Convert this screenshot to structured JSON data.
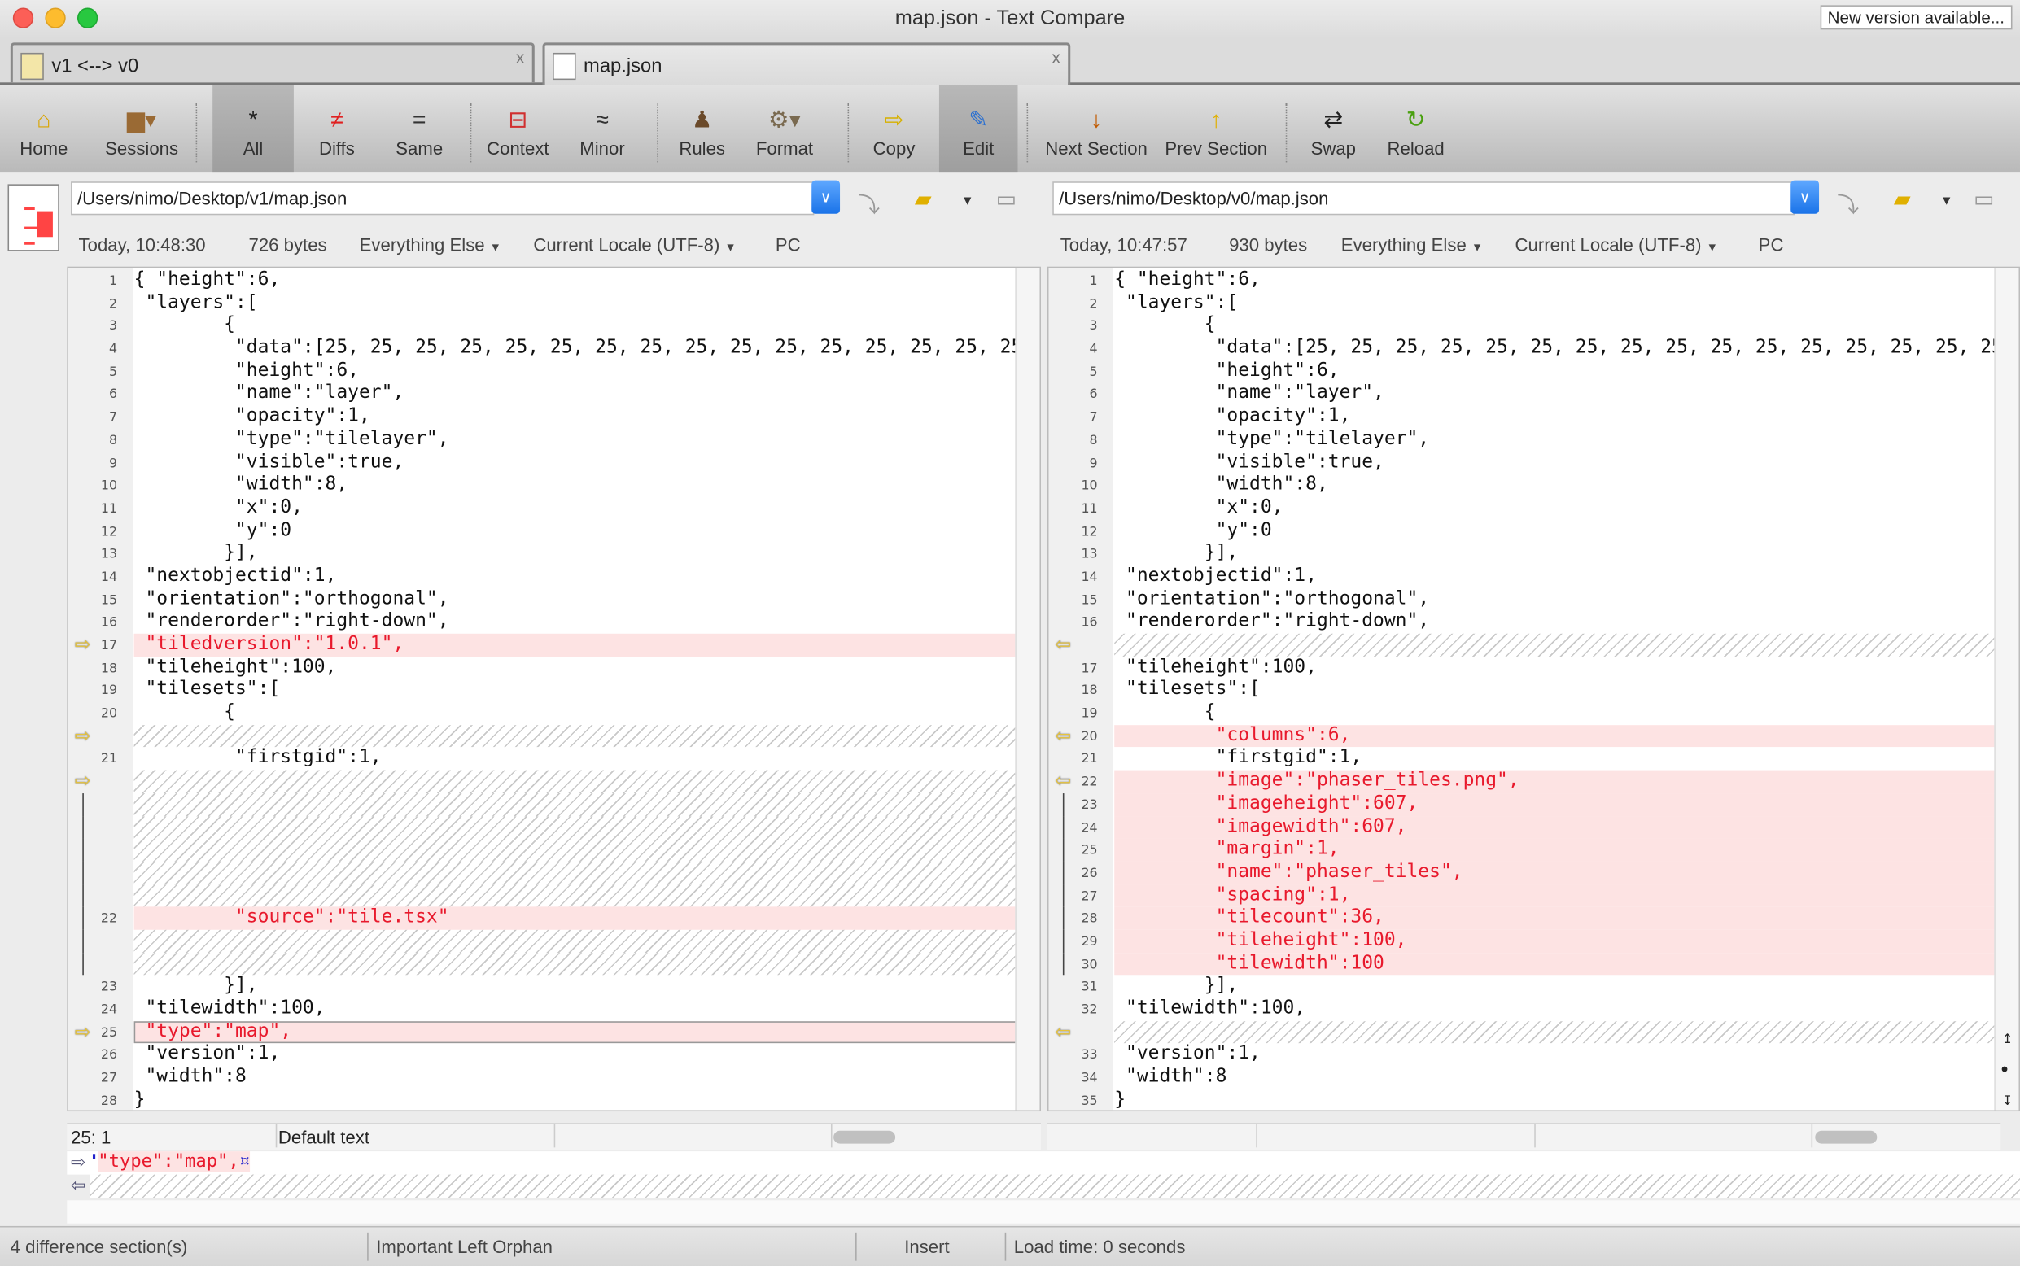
{
  "window": {
    "title": "map.json - Text Compare",
    "new_version": "New version available..."
  },
  "tabs": [
    {
      "label": "v1 <--> v0",
      "icon": "folder-compare-icon",
      "close": "x"
    },
    {
      "label": "map.json",
      "icon": "text-compare-icon",
      "close": "x"
    }
  ],
  "toolbar": [
    {
      "label": "Home",
      "icon": "home-icon",
      "glyph": "⌂",
      "color": "#d9a400"
    },
    {
      "label": "Sessions",
      "icon": "briefcase-icon",
      "glyph": "▆▾",
      "color": "#9a6a34"
    },
    {
      "label": "All",
      "icon": "asterisk-icon",
      "glyph": "*",
      "color": "#222",
      "pressed": true
    },
    {
      "label": "Diffs",
      "icon": "not-equal-icon",
      "glyph": "≠",
      "color": "#e02020"
    },
    {
      "label": "Same",
      "icon": "equal-icon",
      "glyph": "=",
      "color": "#333"
    },
    {
      "label": "Context",
      "icon": "context-icon",
      "glyph": "⊟",
      "color": "#d03030"
    },
    {
      "label": "Minor",
      "icon": "approx-icon",
      "glyph": "≈",
      "color": "#333"
    },
    {
      "label": "Rules",
      "icon": "referee-icon",
      "glyph": "♟",
      "color": "#6b4a2a"
    },
    {
      "label": "Format",
      "icon": "format-gear-icon",
      "glyph": "⚙▾",
      "color": "#7a6a50"
    },
    {
      "label": "Copy",
      "icon": "copy-arrow-icon",
      "glyph": "⇨",
      "color": "#d6b000"
    },
    {
      "label": "Edit",
      "icon": "edit-pencil-icon",
      "glyph": "✎",
      "color": "#2a6fd0",
      "pressed": true
    },
    {
      "label": "Next Section",
      "icon": "arrow-down-icon",
      "glyph": "↓",
      "color": "#c05a00"
    },
    {
      "label": "Prev Section",
      "icon": "arrow-up-icon",
      "glyph": "↑",
      "color": "#e0b000"
    },
    {
      "label": "Swap",
      "icon": "swap-icon",
      "glyph": "⇄",
      "color": "#222"
    },
    {
      "label": "Reload",
      "icon": "reload-icon",
      "glyph": "↻",
      "color": "#4aa010"
    }
  ],
  "left": {
    "path": "/Users/nimo/Desktop/v1/map.json",
    "date": "Today, 10:48:30",
    "size": "726 bytes",
    "rules": "Everything Else",
    "encoding": "Current Locale (UTF-8)",
    "line_endings": "PC",
    "cursor": "25: 1",
    "text_type": "Default text",
    "rows": [
      {
        "n": "1",
        "t": "{ \"height\":6,",
        "k": "same"
      },
      {
        "n": "2",
        "t": " \"layers\":[",
        "k": "same"
      },
      {
        "n": "3",
        "t": "        {",
        "k": "same"
      },
      {
        "n": "4",
        "t": "         \"data\":[25, 25, 25, 25, 25, 25, 25, 25, 25, 25, 25, 25, 25, 25, 25, 25",
        "k": "same"
      },
      {
        "n": "5",
        "t": "         \"height\":6,",
        "k": "same"
      },
      {
        "n": "6",
        "t": "         \"name\":\"layer\",",
        "k": "same"
      },
      {
        "n": "7",
        "t": "         \"opacity\":1,",
        "k": "same"
      },
      {
        "n": "8",
        "t": "         \"type\":\"tilelayer\",",
        "k": "same"
      },
      {
        "n": "9",
        "t": "         \"visible\":true,",
        "k": "same"
      },
      {
        "n": "10",
        "t": "         \"width\":8,",
        "k": "same"
      },
      {
        "n": "11",
        "t": "         \"x\":0,",
        "k": "same"
      },
      {
        "n": "12",
        "t": "         \"y\":0",
        "k": "same"
      },
      {
        "n": "13",
        "t": "        }],",
        "k": "same"
      },
      {
        "n": "14",
        "t": " \"nextobjectid\":1,",
        "k": "same"
      },
      {
        "n": "15",
        "t": " \"orientation\":\"orthogonal\",",
        "k": "same"
      },
      {
        "n": "16",
        "t": " \"renderorder\":\"right-down\",",
        "k": "same"
      },
      {
        "n": "17",
        "t": " \"tiledversion\":\"1.0.1\",",
        "k": "diff",
        "m": "arrow-right"
      },
      {
        "n": "18",
        "t": " \"tileheight\":100,",
        "k": "same"
      },
      {
        "n": "19",
        "t": " \"tilesets\":[",
        "k": "same"
      },
      {
        "n": "20",
        "t": "        {",
        "k": "same"
      },
      {
        "n": "",
        "t": "",
        "k": "filler",
        "m": "arrow-right"
      },
      {
        "n": "21",
        "t": "         \"firstgid\":1,",
        "k": "same"
      },
      {
        "n": "",
        "t": "",
        "k": "filler",
        "m": "arrow-right"
      },
      {
        "n": "",
        "t": "",
        "k": "filler",
        "m": "bracket"
      },
      {
        "n": "",
        "t": "",
        "k": "filler",
        "m": "bracket"
      },
      {
        "n": "",
        "t": "",
        "k": "filler",
        "m": "bracket"
      },
      {
        "n": "",
        "t": "",
        "k": "filler",
        "m": "bracket"
      },
      {
        "n": "",
        "t": "",
        "k": "filler",
        "m": "bracket"
      },
      {
        "n": "22",
        "t": "         \"source\":\"tile.tsx\"",
        "k": "diff",
        "m": "bracket"
      },
      {
        "n": "",
        "t": "",
        "k": "filler",
        "m": "bracket"
      },
      {
        "n": "",
        "t": "",
        "k": "filler",
        "m": "bracket"
      },
      {
        "n": "23",
        "t": "        }],",
        "k": "same"
      },
      {
        "n": "24",
        "t": " \"tilewidth\":100,",
        "k": "same"
      },
      {
        "n": "25",
        "t": " \"type\":\"map\",",
        "k": "diff",
        "m": "arrow-right",
        "current": true
      },
      {
        "n": "26",
        "t": " \"version\":1,",
        "k": "same"
      },
      {
        "n": "27",
        "t": " \"width\":8",
        "k": "same"
      },
      {
        "n": "28",
        "t": "}",
        "k": "same"
      }
    ]
  },
  "right": {
    "path": "/Users/nimo/Desktop/v0/map.json",
    "date": "Today, 10:47:57",
    "size": "930 bytes",
    "rules": "Everything Else",
    "encoding": "Current Locale (UTF-8)",
    "line_endings": "PC",
    "rows": [
      {
        "n": "1",
        "t": "{ \"height\":6,",
        "k": "same"
      },
      {
        "n": "2",
        "t": " \"layers\":[",
        "k": "same"
      },
      {
        "n": "3",
        "t": "        {",
        "k": "same"
      },
      {
        "n": "4",
        "t": "         \"data\":[25, 25, 25, 25, 25, 25, 25, 25, 25, 25, 25, 25, 25, 25, 25, 25",
        "k": "same"
      },
      {
        "n": "5",
        "t": "         \"height\":6,",
        "k": "same"
      },
      {
        "n": "6",
        "t": "         \"name\":\"layer\",",
        "k": "same"
      },
      {
        "n": "7",
        "t": "         \"opacity\":1,",
        "k": "same"
      },
      {
        "n": "8",
        "t": "         \"type\":\"tilelayer\",",
        "k": "same"
      },
      {
        "n": "9",
        "t": "         \"visible\":true,",
        "k": "same"
      },
      {
        "n": "10",
        "t": "         \"width\":8,",
        "k": "same"
      },
      {
        "n": "11",
        "t": "         \"x\":0,",
        "k": "same"
      },
      {
        "n": "12",
        "t": "         \"y\":0",
        "k": "same"
      },
      {
        "n": "13",
        "t": "        }],",
        "k": "same"
      },
      {
        "n": "14",
        "t": " \"nextobjectid\":1,",
        "k": "same"
      },
      {
        "n": "15",
        "t": " \"orientation\":\"orthogonal\",",
        "k": "same"
      },
      {
        "n": "16",
        "t": " \"renderorder\":\"right-down\",",
        "k": "same"
      },
      {
        "n": "",
        "t": "",
        "k": "filler",
        "m": "arrow-left"
      },
      {
        "n": "17",
        "t": " \"tileheight\":100,",
        "k": "same"
      },
      {
        "n": "18",
        "t": " \"tilesets\":[",
        "k": "same"
      },
      {
        "n": "19",
        "t": "        {",
        "k": "same"
      },
      {
        "n": "20",
        "t": "         \"columns\":6,",
        "k": "diff",
        "m": "arrow-left"
      },
      {
        "n": "21",
        "t": "         \"firstgid\":1,",
        "k": "same"
      },
      {
        "n": "22",
        "t": "         \"image\":\"phaser_tiles.png\",",
        "k": "diff",
        "m": "arrow-left"
      },
      {
        "n": "23",
        "t": "         \"imageheight\":607,",
        "k": "diff",
        "m": "bracket"
      },
      {
        "n": "24",
        "t": "         \"imagewidth\":607,",
        "k": "diff",
        "m": "bracket"
      },
      {
        "n": "25",
        "t": "         \"margin\":1,",
        "k": "diff",
        "m": "bracket"
      },
      {
        "n": "26",
        "t": "         \"name\":\"phaser_tiles\",",
        "k": "diff",
        "m": "bracket"
      },
      {
        "n": "27",
        "t": "         \"spacing\":1,",
        "k": "diff",
        "m": "bracket"
      },
      {
        "n": "28",
        "t": "         \"tilecount\":36,",
        "k": "diff",
        "m": "bracket"
      },
      {
        "n": "29",
        "t": "         \"tileheight\":100,",
        "k": "diff",
        "m": "bracket"
      },
      {
        "n": "30",
        "t": "         \"tilewidth\":100",
        "k": "diff",
        "m": "bracket"
      },
      {
        "n": "31",
        "t": "        }],",
        "k": "same"
      },
      {
        "n": "32",
        "t": " \"tilewidth\":100,",
        "k": "same"
      },
      {
        "n": "",
        "t": "",
        "k": "filler",
        "m": "arrow-left"
      },
      {
        "n": "33",
        "t": " \"version\":1,",
        "k": "same"
      },
      {
        "n": "34",
        "t": " \"width\":8",
        "k": "same"
      },
      {
        "n": "35",
        "t": "}",
        "k": "same"
      }
    ]
  },
  "preview": {
    "left_line": "\"type\":\"map\",",
    "eol_marker": "¤"
  },
  "status": {
    "sections": "4 difference section(s)",
    "diff_type": "Important Left Orphan",
    "mode": "Insert",
    "load_time": "Load time: 0 seconds"
  },
  "colors": {
    "diff_bg": "#fde3e3",
    "diff_text": "#e8192c",
    "marker": "#e8c43a",
    "accent": "#1a73e8"
  }
}
